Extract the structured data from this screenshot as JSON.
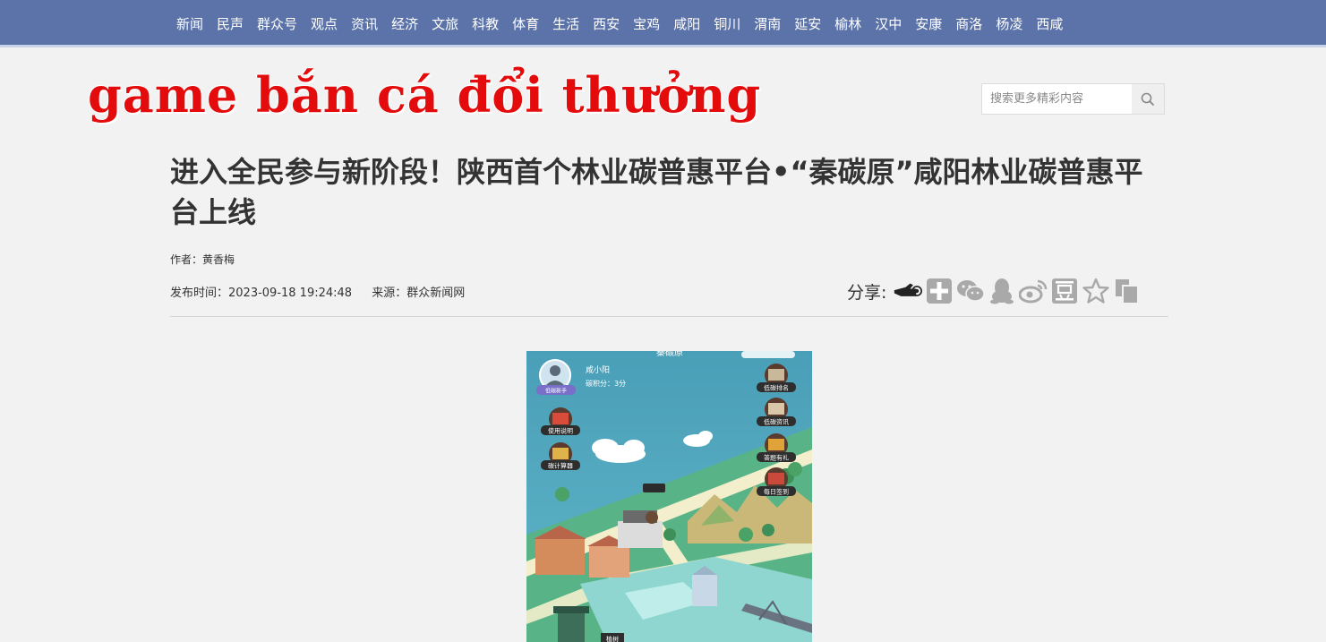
{
  "nav": {
    "items": [
      "新闻",
      "民声",
      "群众号",
      "观点",
      "资讯",
      "经济",
      "文旅",
      "科教",
      "体育",
      "生活",
      "西安",
      "宝鸡",
      "咸阳",
      "铜川",
      "渭南",
      "延安",
      "榆林",
      "汉中",
      "安康",
      "商洛",
      "杨凌",
      "西咸"
    ]
  },
  "logo": {
    "text": "game bắn cá đổi thưởng",
    "color": "#e30b0b"
  },
  "search": {
    "placeholder": "搜索更多精彩内容",
    "icon": "search-icon"
  },
  "article": {
    "title": "进入全民参与新阶段！陕西首个林业碳普惠平台•“秦碳原”咸阳林业碳普惠平台上线",
    "author": "作者：黄香梅",
    "publish_time": "发布时间：2023-09-18 19:24:48",
    "source": "来源：群众新闻网"
  },
  "share": {
    "label": "分享:",
    "icons": [
      "pointer-icon",
      "plus-icon",
      "wechat-icon",
      "qq-icon",
      "weibo-icon",
      "douban-icon",
      "star-icon",
      "copy-icon"
    ]
  },
  "app_screenshot": {
    "top_title": "秦碳原",
    "user_name": "咸小阳",
    "carbon_points": "碳积分：3分",
    "badge": "低碳新手",
    "left_buttons": [
      "使用说明",
      "碳计算器"
    ],
    "right_buttons": [
      "低碳排名",
      "低碳资讯",
      "答题有礼",
      "每日签到"
    ],
    "bottom_tag": "植树"
  },
  "colors": {
    "nav_bg": "#5b73a8",
    "page_bg": "#f2f2f2",
    "logo_red": "#e30b0b"
  }
}
